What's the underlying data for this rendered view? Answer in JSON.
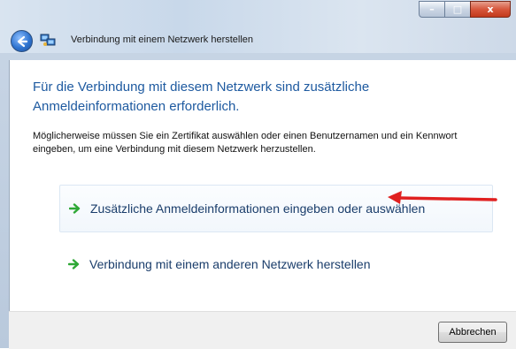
{
  "window": {
    "title": "Verbindung mit einem Netzwerk herstellen",
    "controls": {
      "minimize": "–",
      "maximize": "□",
      "close": "x"
    }
  },
  "main": {
    "heading": "Für die Verbindung mit diesem Netzwerk sind zusätzliche Anmeldeinformationen erforderlich.",
    "description": "Möglicherweise müssen Sie ein Zertifikat auswählen oder einen Benutzernamen und ein Kennwort eingeben, um eine Verbindung mit diesem Netzwerk herzustellen.",
    "options": [
      {
        "label": "Zusätzliche Anmeldeinformationen eingeben oder auswählen",
        "icon": "green-arrow-icon"
      },
      {
        "label": "Verbindung mit einem anderen Netzwerk herstellen",
        "icon": "green-arrow-icon"
      }
    ]
  },
  "footer": {
    "cancel_label": "Abbrechen"
  },
  "colors": {
    "heading": "#1e5aa0",
    "option_text": "#1a3d6b",
    "green_arrow": "#2ea836",
    "annotation_arrow": "#e02020"
  }
}
